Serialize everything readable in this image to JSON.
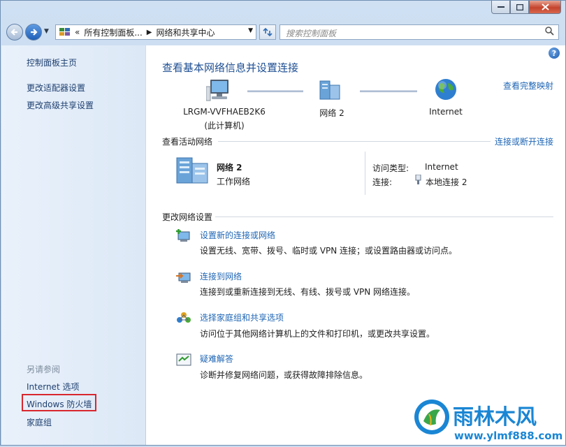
{
  "addressbar": {
    "crumb_sep": "«",
    "crumb1": "所有控制面板...",
    "arrow": "▶",
    "crumb2": "网络和共享中心",
    "search_placeholder": "搜索控制面板"
  },
  "sidebar": {
    "home": "控制面板主页",
    "adapter": "更改适配器设置",
    "advanced": "更改高级共享设置",
    "see_also_title": "另请参阅",
    "internet_options": "Internet 选项",
    "firewall": "Windows 防火墙",
    "homegroup": "家庭组"
  },
  "main": {
    "title": "查看基本网络信息并设置连接",
    "full_map": "查看完整映射",
    "nodes": {
      "computer_name": "LRGM-VVFHAEB2K6",
      "computer_sub": "(此计算机)",
      "network": "网络 2",
      "internet": "Internet"
    },
    "active": {
      "section": "查看活动网络",
      "connect_link": "连接或断开连接",
      "name": "网络 2",
      "type": "工作网络",
      "access_label": "访问类型:",
      "access_value": "Internet",
      "conn_label": "连接:",
      "conn_value": "本地连接 2"
    },
    "change": {
      "section": "更改网络设置",
      "tasks": [
        {
          "title": "设置新的连接或网络",
          "desc": "设置无线、宽带、拨号、临时或 VPN 连接；或设置路由器或访问点。"
        },
        {
          "title": "连接到网络",
          "desc": "连接到或重新连接到无线、有线、拨号或 VPN 网络连接。"
        },
        {
          "title": "选择家庭组和共享选项",
          "desc": "访问位于其他网络计算机上的文件和打印机，或更改共享设置。"
        },
        {
          "title": "疑难解答",
          "desc": "诊断并修复网络问题，或获得故障排除信息。"
        }
      ]
    }
  },
  "watermark": {
    "brand": "雨林木风",
    "url": "www.ylmf888.com"
  },
  "colors": {
    "link": "#1f66b5",
    "title": "#1e4f93",
    "highlight_box": "#d9262e",
    "brand": "#1a86d4"
  }
}
